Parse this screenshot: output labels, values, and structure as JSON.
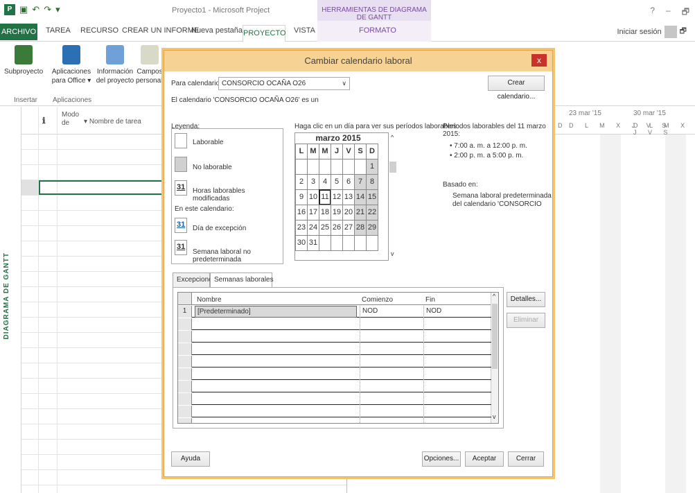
{
  "window": {
    "title": "Proyecto1 - Microsoft Project",
    "context_tab_group": "HERRAMIENTAS DE DIAGRAMA DE GANTT",
    "controls": [
      "?",
      "–",
      "🗗"
    ]
  },
  "ribbon_tabs": {
    "file": "ARCHIVO",
    "items": [
      "TAREA",
      "RECURSO",
      "CREAR UN INFORME",
      "Nueva pestaña",
      "PROYECTO",
      "VISTA",
      "FORMATO"
    ],
    "active": "PROYECTO",
    "signin": "Iniciar sesión"
  },
  "ribbon": {
    "subproyecto": "Subproyecto",
    "aplicaciones_line1": "Aplicaciones",
    "aplicaciones_line2": "para Office ▾",
    "informacion_line1": "Información",
    "informacion_line2": "del proyecto",
    "campos_line1": "Campos",
    "campos_line2": "personalizad",
    "group_insertar": "Insertar",
    "group_aplicaciones": "Aplicaciones"
  },
  "grid": {
    "modo_line1": "Modo",
    "modo_line2": "de",
    "nombre": "Nombre de tarea",
    "info_icon": "ℹ",
    "side_label": "DIAGRAMA DE GANTT",
    "week1": "23 mar '15",
    "week2": "30 mar '15",
    "days_row1": "D L M X J V S",
    "days_row2": "D L M X J V S",
    "lead_day": "D"
  },
  "dialog": {
    "title": "Cambiar calendario laboral",
    "close": "x",
    "para_calendario": "Para calendario:",
    "calendar_value": "CONSORCIO OCAÑA O26",
    "crear": "Crear calendario...",
    "info_line": "El calendario 'CONSORCIO OCAÑA O26' es un",
    "leyenda": "Leyenda:",
    "legend": {
      "laborable": "Laborable",
      "no_laborable": "No laborable",
      "horas_mod": "Horas laborables modificadas",
      "en_este": "En este calendario:",
      "dia_excepcion": "Día de excepción",
      "semana_no_pred": "Semana laboral no predeterminada",
      "num": "31"
    },
    "haga_clic": "Haga clic en un día para ver sus períodos laborables:",
    "calendar": {
      "month": "marzo 2015",
      "weekdays": [
        "L",
        "M",
        "M",
        "J",
        "V",
        "S",
        "D"
      ],
      "weeks": [
        [
          "",
          "",
          "",
          "",
          "",
          "",
          "1"
        ],
        [
          "2",
          "3",
          "4",
          "5",
          "6",
          "7",
          "8"
        ],
        [
          "9",
          "10",
          "11",
          "12",
          "13",
          "14",
          "15"
        ],
        [
          "16",
          "17",
          "18",
          "19",
          "20",
          "21",
          "22"
        ],
        [
          "23",
          "24",
          "25",
          "26",
          "27",
          "28",
          "29"
        ],
        [
          "30",
          "31",
          "",
          "",
          "",
          "",
          ""
        ]
      ],
      "selected_day": "11",
      "scroll_up": "^",
      "scroll_down": "v"
    },
    "periodos_title": "Períodos laborables del 11 marzo 2015:",
    "periodos": [
      "• 7:00 a. m. a 12:00 p. m.",
      "• 2:00 p. m. a 5:00 p. m."
    ],
    "basado_en": "Basado en:",
    "basado_line1": "Semana laboral predeterminada",
    "basado_line2": "del calendario 'CONSORCIO",
    "tabs": [
      "Excepciones",
      "Semanas laborales"
    ],
    "active_tab": "Semanas laborales",
    "table": {
      "headers": [
        "Nombre",
        "Comienzo",
        "Fin"
      ],
      "rows": [
        {
          "num": "1",
          "nombre": "[Predeterminado]",
          "comienzo": "NOD",
          "fin": "NOD"
        }
      ],
      "scroll_up": "^",
      "scroll_down": "v"
    },
    "detalles": "Detalles...",
    "eliminar": "Eliminar",
    "ayuda": "Ayuda",
    "opciones": "Opciones...",
    "aceptar": "Aceptar",
    "cerrar": "Cerrar"
  },
  "colors": {
    "accent": "#217346",
    "dialog_title": "#f6d295",
    "dialog_border": "#e0a44c",
    "close": "#c8322a",
    "context": "#7a4aa0"
  }
}
